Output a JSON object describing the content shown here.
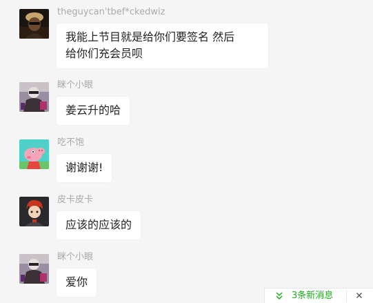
{
  "messages": [
    {
      "sender": "theguycan'tbef*ckedwiz",
      "text": "我能上节目就是给你们要签名 然后\n给你们充会员呗",
      "avatar": "person-dark-avatar"
    },
    {
      "sender": "眯个小眼",
      "text": "姜云升的哈",
      "avatar": "person-mask-avatar"
    },
    {
      "sender": "吃不饱",
      "text": "谢谢谢!",
      "avatar": "peppa-pig-avatar"
    },
    {
      "sender": "皮卡皮卡",
      "text": "应该的应该的",
      "avatar": "cartoon-character-avatar"
    },
    {
      "sender": "眯个小眼",
      "text": "爱你",
      "avatar": "person-mask-avatar"
    }
  ],
  "new_messages": {
    "label": "3条新消息",
    "icon": "double-chevron-down-icon",
    "close_icon": "close-icon",
    "accent_color": "#1aad19"
  },
  "colors": {
    "background": "#f5f5f5",
    "bubble": "#ffffff",
    "sender_text": "#a9a9a9"
  }
}
